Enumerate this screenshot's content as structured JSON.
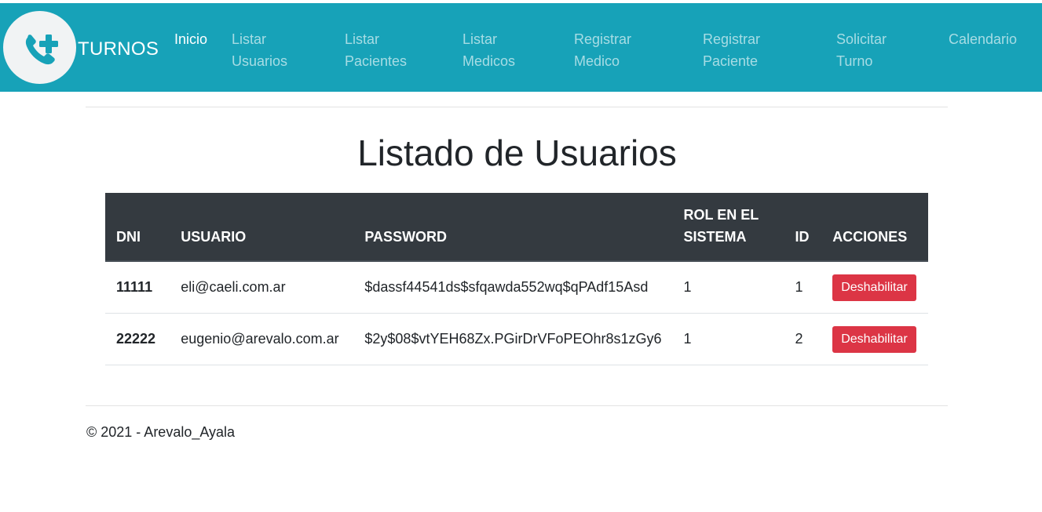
{
  "brand": {
    "name": "TURNOS",
    "logo_icon": "phone-plus-icon"
  },
  "nav": {
    "items": [
      {
        "line1": "Inicio",
        "line2": ""
      },
      {
        "line1": "Listar",
        "line2": "Usuarios"
      },
      {
        "line1": "Listar",
        "line2": "Pacientes"
      },
      {
        "line1": "Listar",
        "line2": "Medicos"
      },
      {
        "line1": "Registrar",
        "line2": "Medico"
      },
      {
        "line1": "Registrar",
        "line2": "Paciente"
      },
      {
        "line1": "Solicitar",
        "line2": "Turno"
      },
      {
        "line1": "Calendario",
        "line2": ""
      }
    ]
  },
  "main": {
    "title": "Listado de Usuarios",
    "table": {
      "headers": {
        "dni": "DNI",
        "usuario": "USUARIO",
        "password": "PASSWORD",
        "rol_line1": "ROL EN EL",
        "rol_line2": "SISTEMA",
        "id": "ID",
        "acciones": "ACCIONES"
      },
      "rows": [
        {
          "dni": "11111",
          "usuario": "eli@caeli.com.ar",
          "password": "$dassf44541ds$sfqawda552wq$qPAdf15Asd",
          "rol": "1",
          "id": "1",
          "action": "Deshabilitar"
        },
        {
          "dni": "22222",
          "usuario": "eugenio@arevalo.com.ar",
          "password": "$2y$08$vtYEH68Zx.PGirDrVFoPEOhr8s1zGy6",
          "rol": "1",
          "id": "2",
          "action": "Deshabilitar"
        }
      ]
    }
  },
  "footer": {
    "text": "© 2021 - Arevalo_Ayala"
  },
  "colors": {
    "navbar": "#17a2b8",
    "table_header": "#343a40",
    "danger": "#dc3545"
  }
}
